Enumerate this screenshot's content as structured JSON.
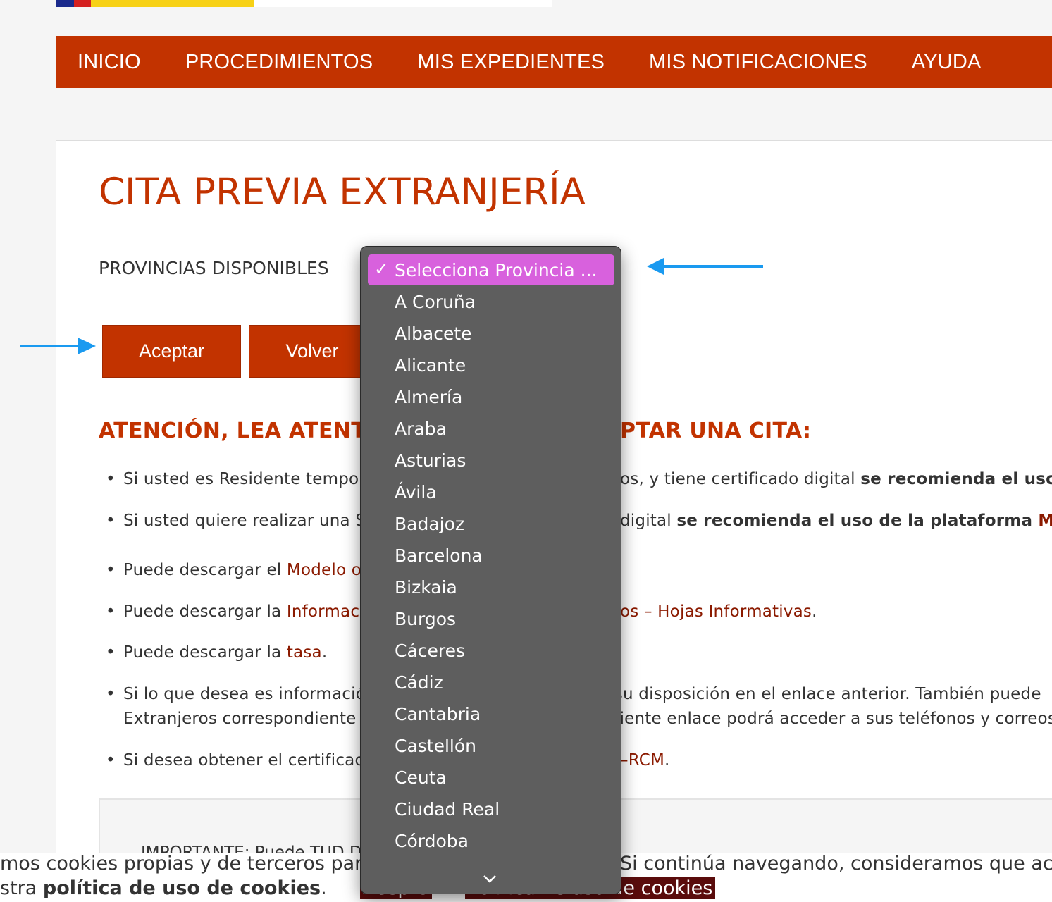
{
  "nav": {
    "items": [
      "INICIO",
      "PROCEDIMIENTOS",
      "MIS EXPEDIENTES",
      "MIS NOTIFICACIONES",
      "AYUDA"
    ]
  },
  "page": {
    "title": "CITA PREVIA EXTRANJERÍA",
    "provinces_label": "PROVINCIAS DISPONIBLES",
    "accept_button": "Aceptar",
    "back_button": "Volver",
    "attention_heading": "ATENCIÓN, LEA ATENTA",
    "attention_heading_right": "PTAR UNA CITA:"
  },
  "info": {
    "li1_a": "Si usted es Residente tempora",
    "li1_b": "os, y tiene certificado digital ",
    "li1_c": "se recomienda el uso d",
    "li2_a": "Si usted quiere realizar una So",
    "li2_b": " digital ",
    "li2_c": "se recomienda el uso de la plataforma ",
    "li2_d": "MERC",
    "li3_a": "Puede descargar el ",
    "li3_link": "Modelo of",
    "li4_a": "Puede descargar la ",
    "li4_link": "Informació",
    "li4_link_right": "os – Hojas Informativas",
    "li4_end": ".",
    "li5_a": "Puede descargar la ",
    "li5_link": "tasa",
    "li5_end": ".",
    "li6_a": "Si lo que desea es información",
    "li6_b": "a su disposición en el enlace anterior. También puede",
    "li6_c": "Extranjeros correspondiente a",
    "li6_d": "guiente enlace podrá acceder a sus teléfonos y correos",
    "li7_a": "Si desea obtener el certificado",
    "li7_link": "–RCM",
    "li7_end": "."
  },
  "important": {
    "text": "IMPORTANTE: Puede                                                 TUD DE ASILO ..."
  },
  "cookie": {
    "line1_left": "mos cookies propias y de terceros para",
    "line1_right": "Si continúa navegando, consideramos que ace",
    "line2_prefix": "stra ",
    "line2_bold": "política de uso de cookies",
    "line2_suffix": ".",
    "accept": "Acepto",
    "policy": "Política de uso de cookies"
  },
  "dropdown": {
    "selected": "Selecciona Provincia ...",
    "check": "✓",
    "options": [
      "A Coruña",
      "Albacete",
      "Alicante",
      "Almería",
      "Araba",
      "Asturias",
      "Ávila",
      "Badajoz",
      "Barcelona",
      "Bizkaia",
      "Burgos",
      "Cáceres",
      "Cádiz",
      "Cantabria",
      "Castellón",
      "Ceuta",
      "Ciudad Real",
      "Córdoba"
    ],
    "more_icon": "chevron-down-icon"
  },
  "colors": {
    "brand": "#c23300",
    "link": "#8b1a00",
    "highlight": "#d861dd",
    "annotation_arrow": "#1a9af0"
  }
}
